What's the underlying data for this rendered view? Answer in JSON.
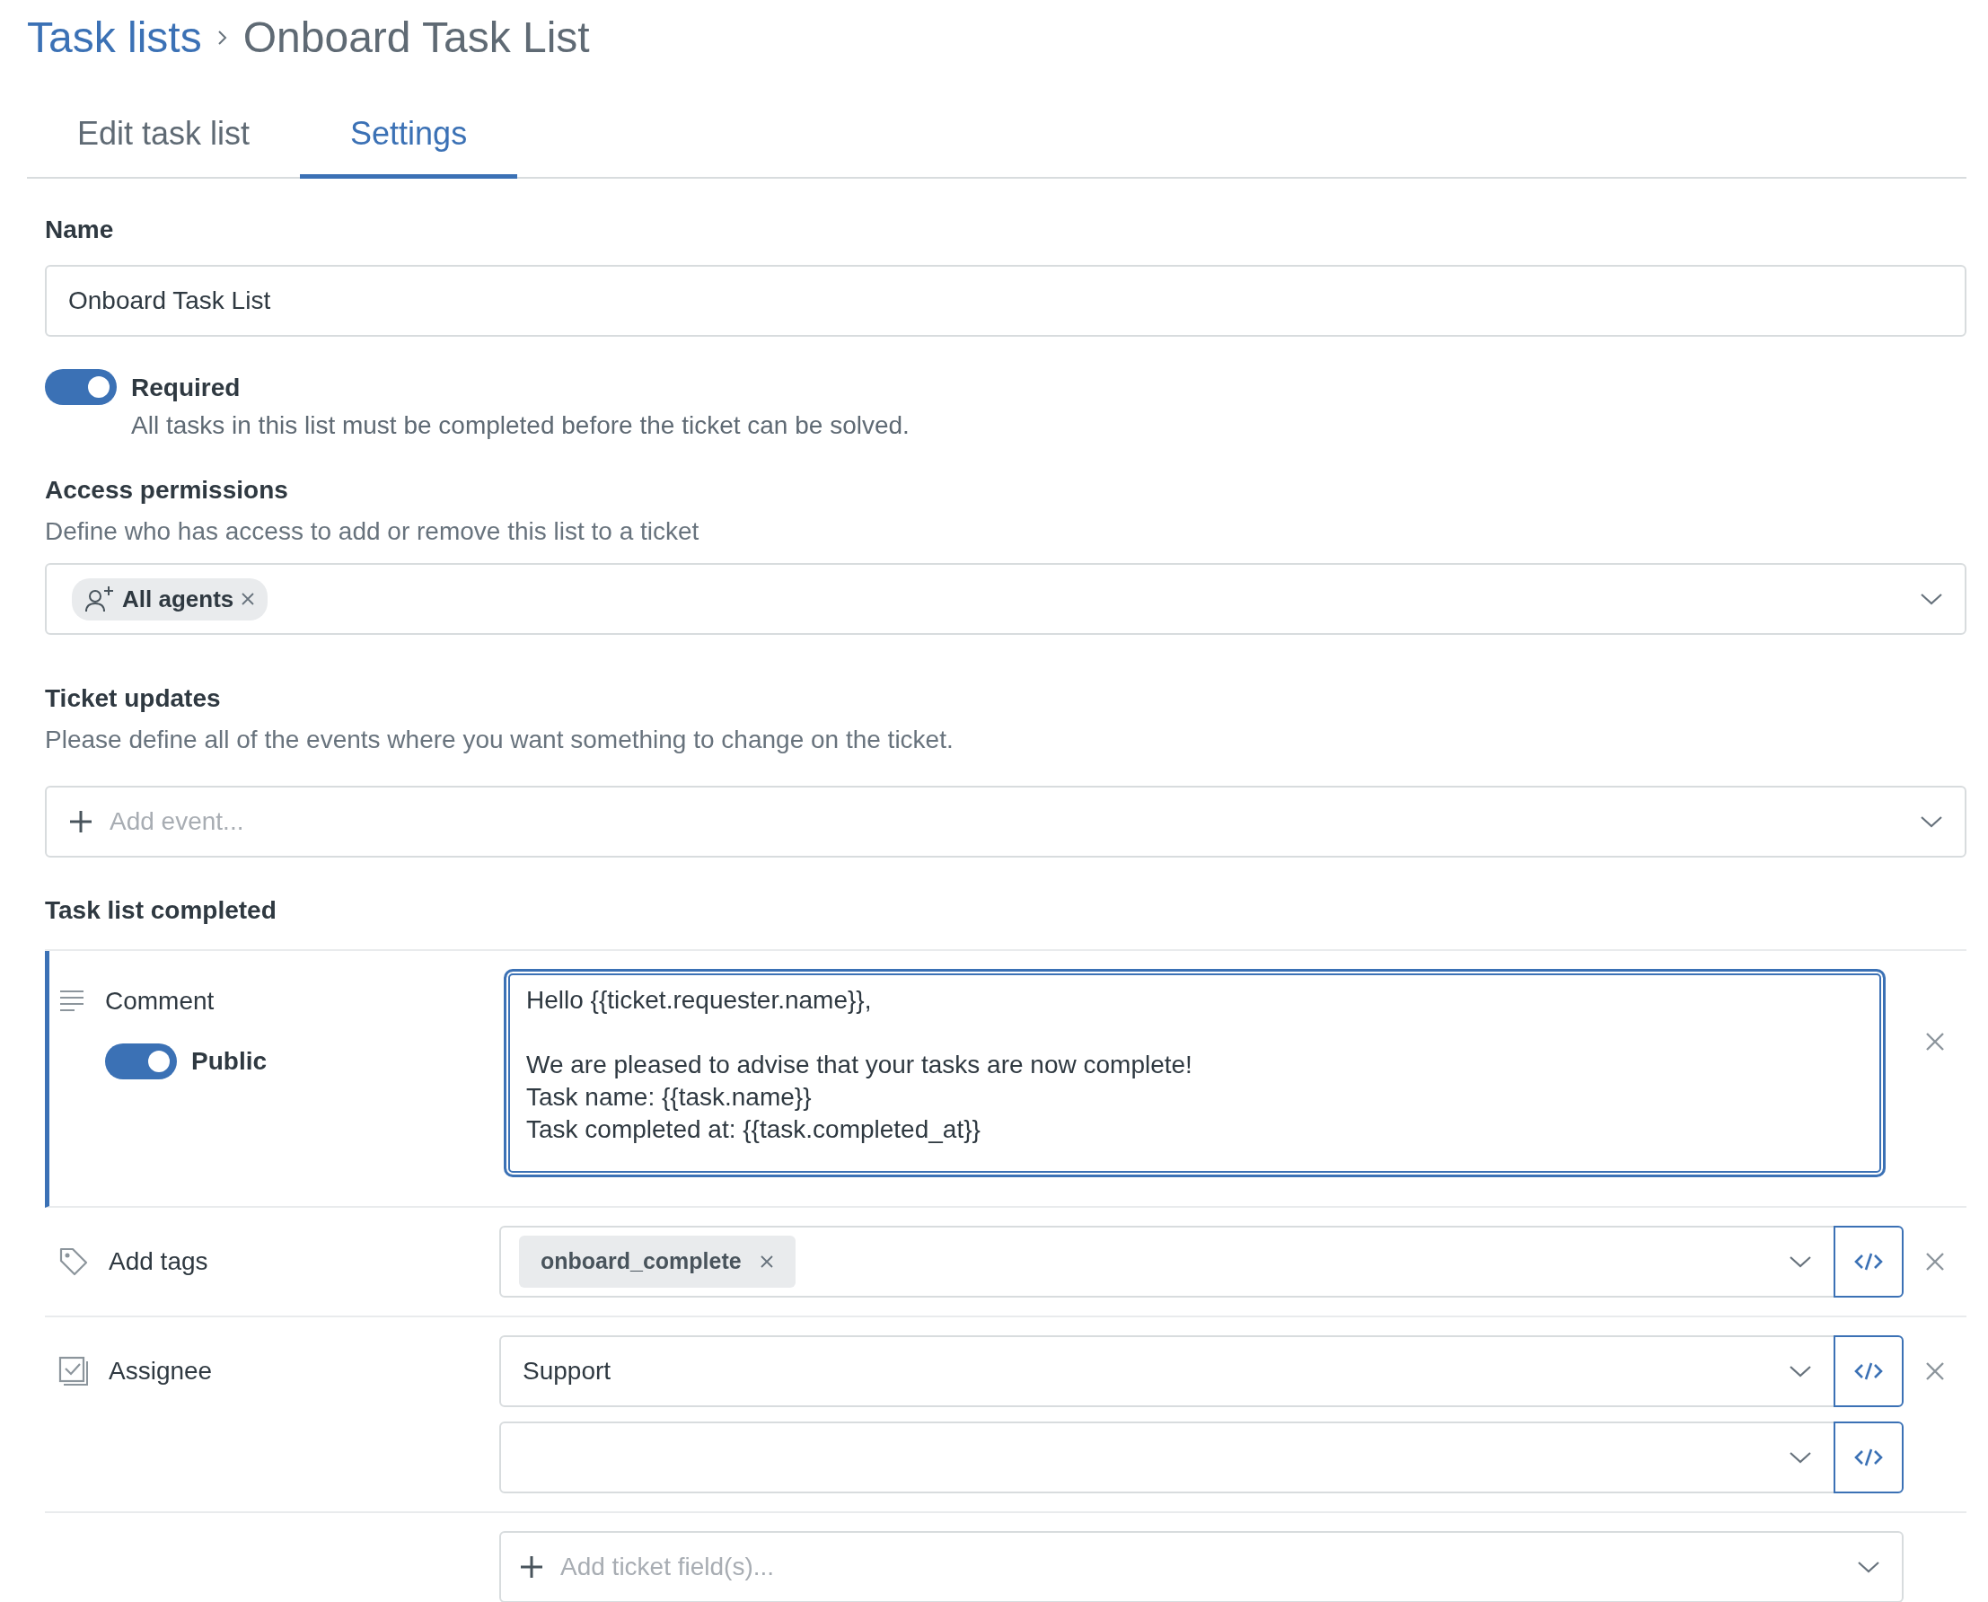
{
  "breadcrumb": {
    "parent": "Task lists",
    "current": "Onboard Task List"
  },
  "tabs": [
    {
      "label": "Edit task list",
      "selected": false
    },
    {
      "label": "Settings",
      "selected": true
    }
  ],
  "name": {
    "label": "Name",
    "value": "Onboard Task List"
  },
  "required": {
    "label": "Required",
    "on": true,
    "description": "All tasks in this list must be completed before the ticket can be solved."
  },
  "access_permissions": {
    "label": "Access permissions",
    "description": "Define who has access to add or remove this list to a ticket",
    "tags": [
      {
        "label": "All agents"
      }
    ]
  },
  "ticket_updates": {
    "label": "Ticket updates",
    "description": "Please define all of the events where you want something to change on the ticket.",
    "placeholder": "Add event..."
  },
  "task_list_completed": {
    "title": "Task list completed",
    "actions": [
      {
        "kind": "comment",
        "label": "Comment",
        "selected": true,
        "public": {
          "label": "Public",
          "on": true
        },
        "body": "Hello {{ticket.requester.name}},\n\nWe are pleased to advise that your tasks are now complete!\nTask name: {{task.name}}\nTask completed at: {{task.completed_at}}"
      },
      {
        "kind": "tags",
        "label": "Add tags",
        "selected": false,
        "tags": [
          "onboard_complete"
        ]
      },
      {
        "kind": "assignee",
        "label": "Assignee",
        "selected": false,
        "value": "Support"
      }
    ],
    "add_field": {
      "placeholder": "Add ticket field(s)..."
    }
  }
}
